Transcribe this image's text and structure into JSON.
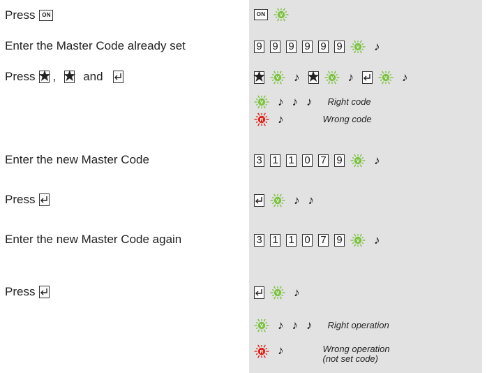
{
  "instructions": [
    {
      "text": "Press",
      "icons": [
        "ON"
      ]
    },
    {
      "text": "Enter the Master Code already set"
    },
    {
      "text": "Press",
      "icons": [
        "star",
        "star",
        "enter"
      ],
      "between": [
        ",",
        "and"
      ]
    },
    {
      "text": "Enter the new Master Code"
    },
    {
      "text": "Press",
      "icons": [
        "enter"
      ]
    },
    {
      "text": "Enter the new Master Code again"
    },
    {
      "text": "Press",
      "icons": [
        "enter"
      ]
    }
  ],
  "keys": {
    "on": "ON",
    "star": "★",
    "enter_icon": "enter-key-icon"
  },
  "sequences": {
    "old_code": [
      "9",
      "9",
      "9",
      "9",
      "9",
      "9"
    ],
    "new_code": [
      "3",
      "1",
      "1",
      "0",
      "7",
      "9"
    ],
    "new_code_again": [
      "3",
      "1",
      "1",
      "0",
      "7",
      "9"
    ]
  },
  "led_labels": {
    "green": "V",
    "red": "R"
  },
  "results": {
    "right_code": "Right code",
    "wrong_code": "Wrong code",
    "right_operation": "Right operation",
    "wrong_operation": "Wrong operation\n(not set code)"
  },
  "colors": {
    "green_led": "#7dc242",
    "red_led": "#e0251b",
    "panel": "#e2e2e2"
  }
}
